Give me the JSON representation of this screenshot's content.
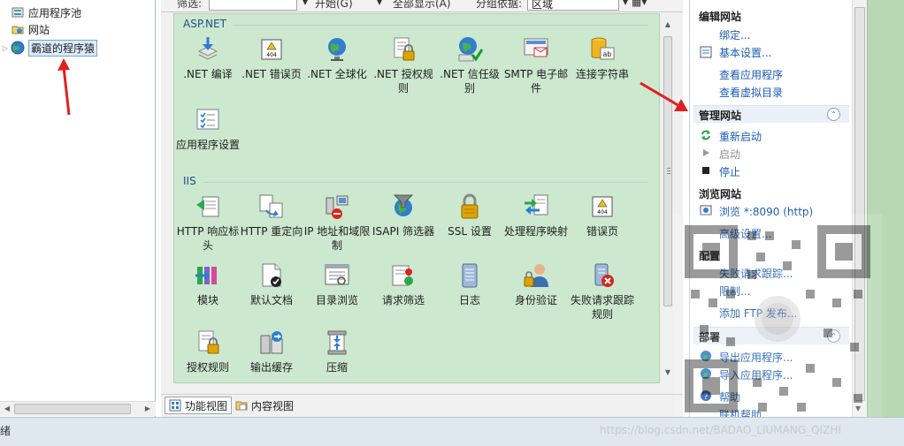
{
  "tree": {
    "items": [
      {
        "label": "应用程序池",
        "icon": "app-pool-icon",
        "expander": ""
      },
      {
        "label": "网站",
        "icon": "sites-folder-icon",
        "expander": ""
      },
      {
        "label": "霸道的程序猿",
        "icon": "globe-site-icon",
        "expander": "▷",
        "selected": true
      }
    ]
  },
  "toolbar": {
    "filter_label": "筛选:",
    "filter_value": "",
    "go_label": "开始(G)",
    "show_all_label": "全部显示(A)",
    "group_by_label": "分组依据:",
    "group_by_value": "区域"
  },
  "groups": [
    {
      "title": "ASP.NET",
      "features": [
        {
          "label": ".NET 编译",
          "icon": "dotnet-compile-icon"
        },
        {
          "label": ".NET 错误页",
          "icon": "error-page-404-icon"
        },
        {
          "label": ".NET 全球化",
          "icon": "globalization-icon"
        },
        {
          "label": ".NET 授权规则",
          "icon": "authorization-rules-icon"
        },
        {
          "label": ".NET 信任级别",
          "icon": "trust-level-icon"
        },
        {
          "label": "SMTP 电子邮件",
          "icon": "smtp-email-icon"
        },
        {
          "label": "连接字符串",
          "icon": "connection-string-icon"
        },
        {
          "label": "应用程序设置",
          "icon": "app-settings-icon"
        }
      ]
    },
    {
      "title": "IIS",
      "features": [
        {
          "label": "HTTP 响应标头",
          "icon": "http-headers-icon"
        },
        {
          "label": "HTTP 重定向",
          "icon": "http-redirect-icon"
        },
        {
          "label": "IP 地址和域限制",
          "icon": "ip-restrictions-icon"
        },
        {
          "label": "ISAPI 筛选器",
          "icon": "isapi-filter-icon"
        },
        {
          "label": "SSL 设置",
          "icon": "ssl-lock-icon"
        },
        {
          "label": "处理程序映射",
          "icon": "handler-mappings-icon"
        },
        {
          "label": "错误页",
          "icon": "error-page-icon"
        },
        {
          "label": "模块",
          "icon": "modules-icon"
        },
        {
          "label": "默认文档",
          "icon": "default-document-icon"
        },
        {
          "label": "目录浏览",
          "icon": "directory-browsing-icon"
        },
        {
          "label": "请求筛选",
          "icon": "request-filtering-icon"
        },
        {
          "label": "日志",
          "icon": "logging-icon"
        },
        {
          "label": "身份验证",
          "icon": "authentication-icon"
        },
        {
          "label": "失败请求跟踪规则",
          "icon": "failed-request-tracing-icon"
        },
        {
          "label": "授权规则",
          "icon": "iis-authorization-icon"
        },
        {
          "label": "输出缓存",
          "icon": "output-caching-icon"
        },
        {
          "label": "压缩",
          "icon": "compression-icon"
        }
      ]
    }
  ],
  "view_tabs": {
    "features_view": "功能视图",
    "content_view": "内容视图"
  },
  "actions": {
    "edit_site": {
      "title": "编辑网站",
      "bindings": "绑定...",
      "basic_settings": "基本设置...",
      "view_applications": "查看应用程序",
      "view_virtual_dirs": "查看虚拟目录"
    },
    "manage_site": {
      "title": "管理网站",
      "restart": "重新启动",
      "start": "启动",
      "stop": "停止",
      "collapse_glyph": "⌃"
    },
    "browse_site": {
      "title": "浏览网站",
      "browse_link": "浏览 *:8090 (http)",
      "advanced_settings": "高级设置..."
    },
    "configure": {
      "title": "配置",
      "failed_request_tracing": "失败请求跟踪...",
      "limits": "限制...",
      "add_ftp": "添加 FTP 发布..."
    },
    "deploy": {
      "title": "部署",
      "export_app": "导出应用程序...",
      "import_app": "导入应用程序...",
      "collapse_glyph": "⌃"
    },
    "help": {
      "help": "帮助",
      "online_help": "联机帮助"
    }
  },
  "status_bar": {
    "text": "绪"
  },
  "watermark": "https://blog.csdn.net/BADAO_LIUMANG_QIZHI",
  "colors": {
    "feature_bg": "#cce8cf",
    "group_header": "#1f4e8c",
    "action_link": "#1a5bb4",
    "annotation_arrow": "#e02020"
  }
}
